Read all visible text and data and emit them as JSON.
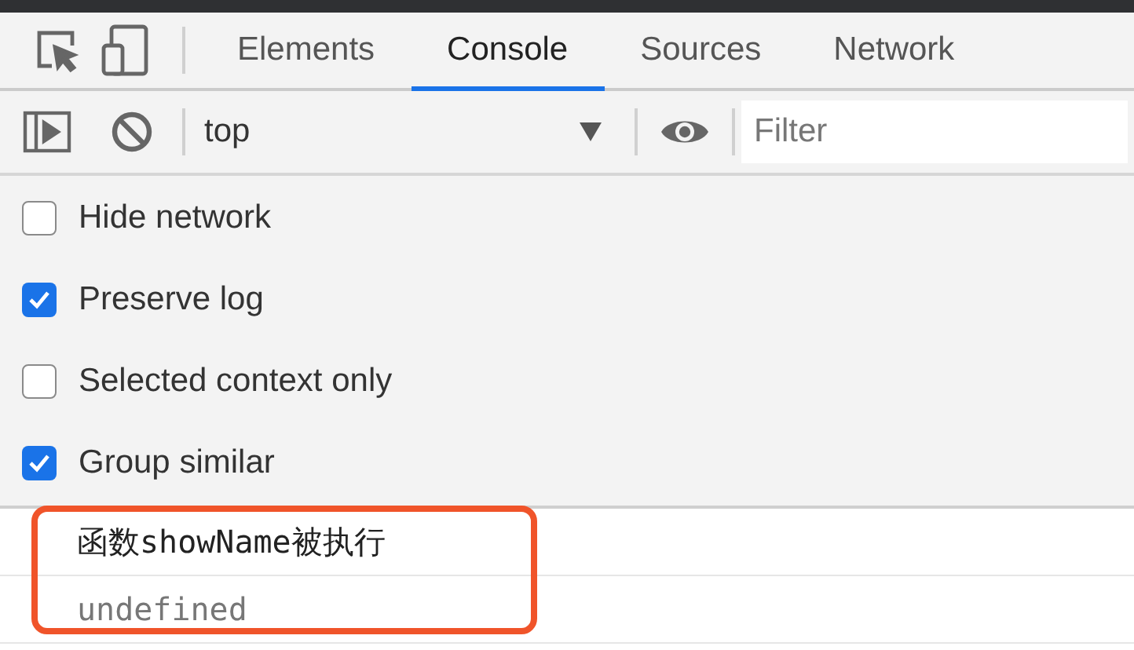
{
  "tabs": [
    {
      "label": "Elements",
      "selected": false
    },
    {
      "label": "Console",
      "selected": true
    },
    {
      "label": "Sources",
      "selected": false
    },
    {
      "label": "Network",
      "selected": false
    }
  ],
  "toolbar": {
    "context": "top",
    "filter": {
      "placeholder": "Filter"
    }
  },
  "settings": [
    {
      "label": "Hide network",
      "checked": false
    },
    {
      "label": "Preserve log",
      "checked": true
    },
    {
      "label": "Selected context only",
      "checked": false
    },
    {
      "label": "Group similar",
      "checked": true
    }
  ],
  "messages": [
    {
      "kind": "log",
      "text": "函数showName被执行"
    },
    {
      "kind": "result",
      "text": "undefined"
    }
  ]
}
